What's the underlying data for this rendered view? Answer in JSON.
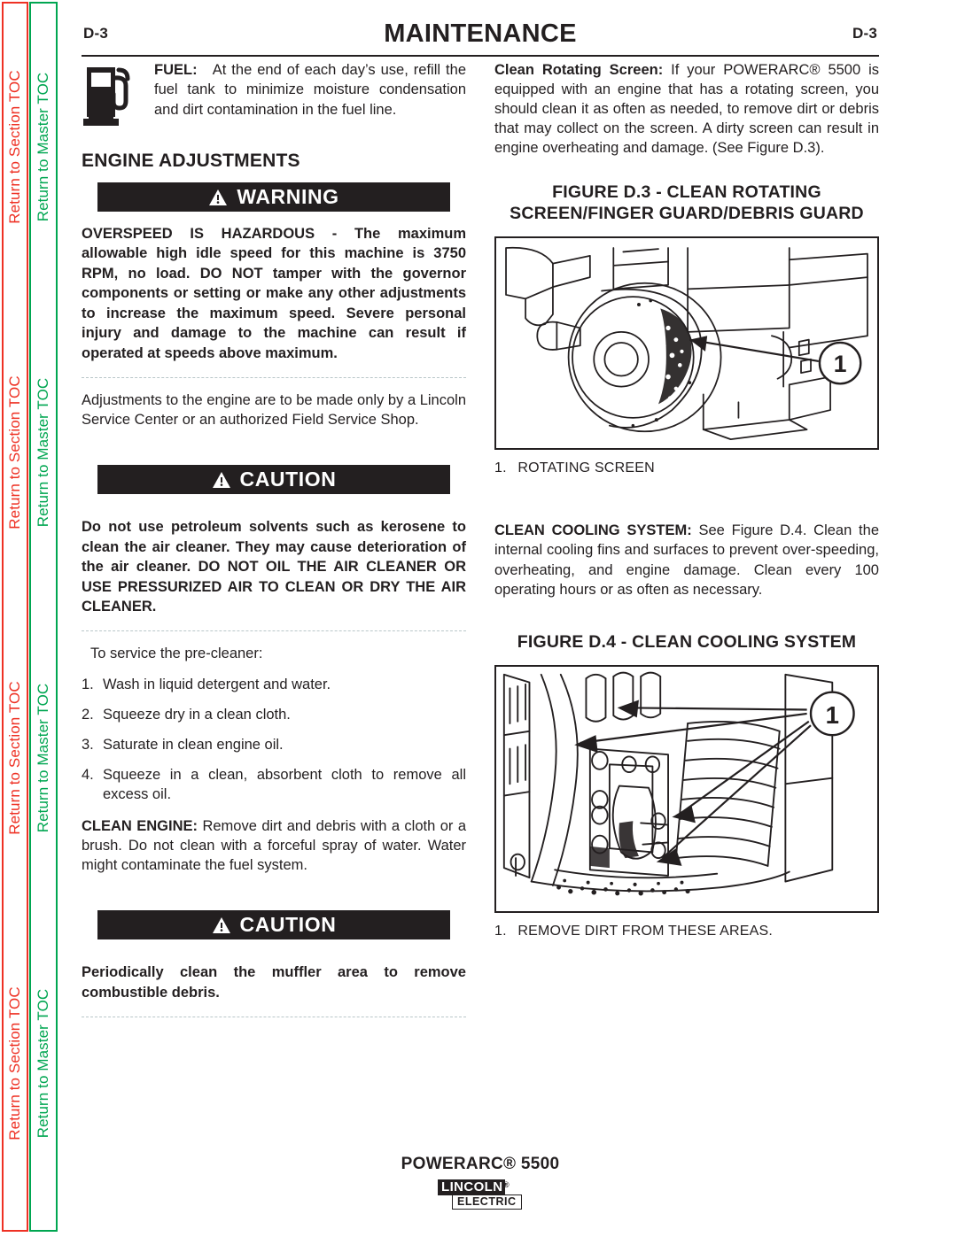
{
  "sidebar": {
    "section_toc_label": "Return to Section TOC",
    "master_toc_label": "Return to Master TOC",
    "section_color": "#ee3124",
    "master_color": "#00a651"
  },
  "header": {
    "folio_left": "D-3",
    "title": "MAINTENANCE",
    "folio_right": "D-3"
  },
  "left_column": {
    "fuel": {
      "icon": "fuel-pump-icon",
      "lead": "FUEL:",
      "text": "At the end of each day’s use, refill the fuel tank to minimize moisture condensation and dirt contamination in the fuel line."
    },
    "section_heading": "ENGINE ADJUSTMENTS",
    "warning": {
      "icon": "warning-triangle-icon",
      "label": "WARNING",
      "text": "OVERSPEED IS HAZARDOUS - The maximum allowable high idle speed for this machine is 3750 RPM, no load. DO NOT tamper with the governor components or setting or make any other adjustments to increase the maximum speed. Severe personal injury and damage to the machine can result if operated at speeds above maximum."
    },
    "after_warning_text": "Adjustments to the engine are to be made only by a Lincoln Service Center or an authorized Field Service Shop.",
    "caution_1": {
      "icon": "warning-triangle-icon",
      "label": "CAUTION",
      "text": "Do not use petroleum solvents such as kerosene to clean the air cleaner.  They may cause deterioration of  the air cleaner.  DO NOT OIL THE AIR CLEANER  OR USE PRESSURIZED AIR TO CLEAN OR DRY THE AIR CLEANER."
    },
    "precleaner_intro": "To service the pre-cleaner:",
    "precleaner_steps": [
      {
        "num": "1.",
        "text": "Wash in liquid detergent and water."
      },
      {
        "num": "2.",
        "text": "Squeeze dry in a clean cloth."
      },
      {
        "num": "3.",
        "text": "Saturate in clean engine oil."
      },
      {
        "num": "4.",
        "text": "Squeeze in a clean, absorbent cloth to remove all excess oil."
      }
    ],
    "clean_engine": {
      "lead": "CLEAN ENGINE:",
      "text": "Remove dirt and debris with a cloth or a brush.  Do not clean with a forceful spray of water. Water might contaminate the fuel system."
    },
    "caution_2": {
      "icon": "warning-triangle-icon",
      "label": "CAUTION",
      "text": "Periodically clean the muffler area to remove combustible debris."
    }
  },
  "right_column": {
    "rotating_screen": {
      "lead": "Clean Rotating Screen:",
      "text": "If your POWERARC® 5500 is equipped with an engine that has a rotating screen, you should clean it as often as needed, to remove dirt or debris that may collect on the screen. A dirty screen can result in engine overheating and damage. (See Figure D.3)."
    },
    "figure_d3": {
      "title": "FIGURE D.3 - CLEAN ROTATING SCREEN/FINGER GUARD/DEBRIS GUARD",
      "callout_number": "1",
      "caption_num": "1.",
      "caption_text": "ROTATING SCREEN"
    },
    "cooling_system": {
      "lead": "CLEAN COOLING SYSTEM:",
      "text": "See Figure D.4.  Clean the internal cooling fins and surfaces to prevent over-speeding, overheating, and engine damage.  Clean every 100 operating hours or as often as necessary."
    },
    "figure_d4": {
      "title": "FIGURE D.4 - CLEAN COOLING SYSTEM",
      "callout_number": "1",
      "caption_num": "1.",
      "caption_text": "REMOVE DIRT FROM THESE AREAS."
    }
  },
  "footer": {
    "model": "POWERARC® 5500",
    "logo_top": "LINCOLN",
    "logo_reg": "®",
    "logo_bottom": "ELECTRIC"
  }
}
